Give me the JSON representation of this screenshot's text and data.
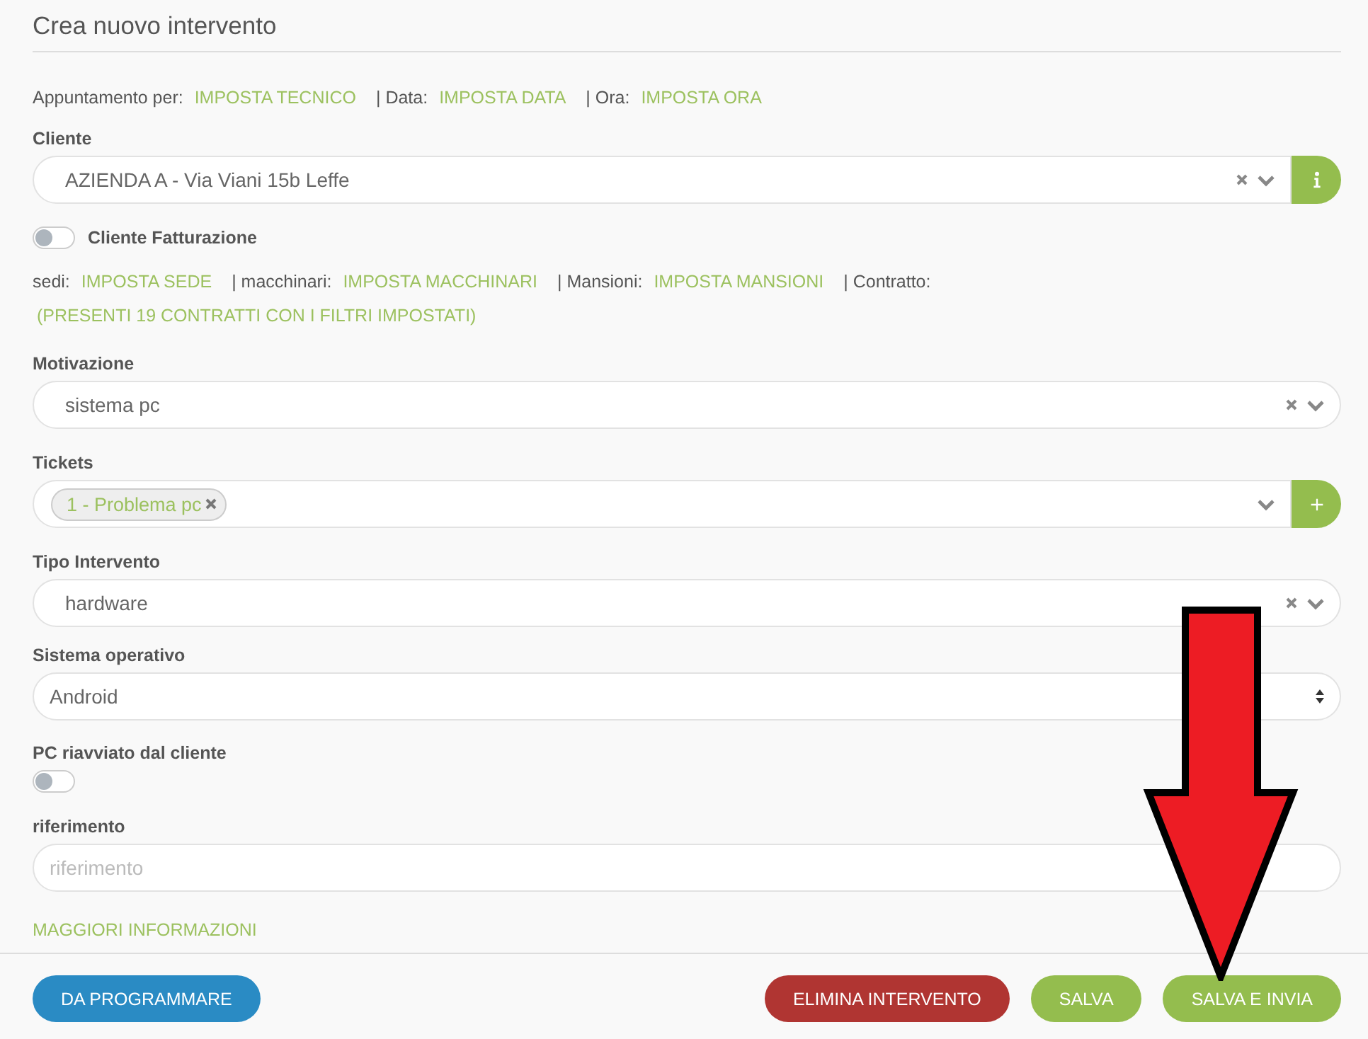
{
  "title": "Crea nuovo intervento",
  "rows": [
    {
      "kind": "links",
      "items": [
        {
          "label": "Appuntamento per:",
          "value": "IMPOSTA TECNICO"
        },
        {
          "label": "| Data:",
          "value": "IMPOSTA DATA"
        },
        {
          "label": "| Ora:",
          "value": "IMPOSTA ORA"
        }
      ]
    },
    {
      "kind": "select",
      "label": "Cliente",
      "value": "AZIENDA A - Via Viani 15b Leffe",
      "clearable": true,
      "addon": {
        "kind": "info"
      }
    },
    {
      "kind": "toggle",
      "text": "Cliente Fatturazione",
      "on": false
    },
    {
      "kind": "links",
      "items": [
        {
          "label": "sedi:",
          "value": "IMPOSTA SEDE"
        },
        {
          "label": "| macchinari:",
          "value": "IMPOSTA MACCHINARI"
        },
        {
          "label": "| Mansioni:",
          "value": "IMPOSTA MANSIONI"
        },
        {
          "label": "| Contratto:"
        }
      ]
    },
    {
      "kind": "note",
      "text": "(PRESENTI 19 CONTRATTI CON I FILTRI IMPOSTATI)"
    },
    {
      "kind": "select",
      "label": "Motivazione",
      "value": "sistema pc",
      "clearable": true
    },
    {
      "kind": "tags",
      "label": "Tickets",
      "tags": [
        "1 - Problema pc"
      ],
      "addon": {
        "kind": "plus"
      }
    },
    {
      "kind": "select",
      "label": "Tipo Intervento",
      "value": "hardware",
      "clearable": true
    },
    {
      "kind": "native",
      "label": "Sistema operativo",
      "value": "Android"
    },
    {
      "kind": "toggle",
      "label": "PC riavviato dal cliente",
      "on": false
    },
    {
      "kind": "text",
      "label": "riferimento",
      "placeholder": "riferimento"
    },
    {
      "kind": "more",
      "text": "MAGGIORI INFORMAZIONI"
    }
  ],
  "footer": {
    "left": [
      {
        "label": "DA PROGRAMMARE",
        "kind": "primary"
      }
    ],
    "right": [
      {
        "label": "ELIMINA INTERVENTO",
        "kind": "danger"
      },
      {
        "label": "SALVA",
        "kind": "success"
      },
      {
        "label": "SALVA E INVIA",
        "kind": "success"
      }
    ]
  }
}
